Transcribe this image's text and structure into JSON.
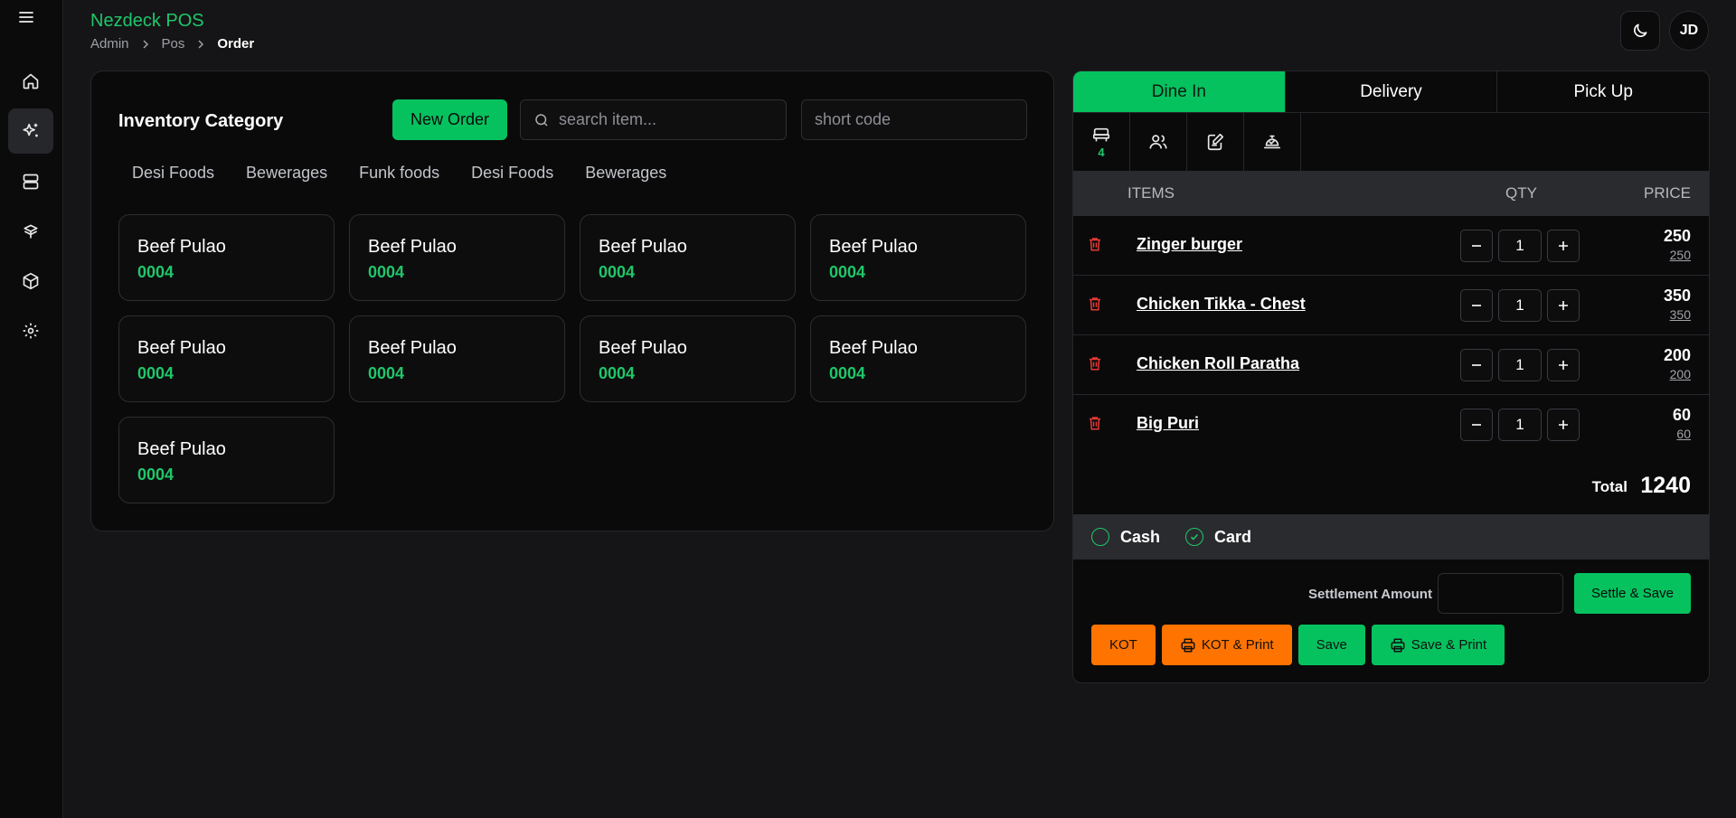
{
  "header": {
    "app_title": "Nezdeck POS",
    "breadcrumb": [
      "Admin",
      "Pos",
      "Order"
    ],
    "avatar_initials": "JD"
  },
  "sidebar": {
    "items": [
      {
        "icon": "home-icon"
      },
      {
        "icon": "sparkle-icon",
        "active": true
      },
      {
        "icon": "server-icon"
      },
      {
        "icon": "layers-icon"
      },
      {
        "icon": "box-icon"
      },
      {
        "icon": "gear-icon"
      }
    ]
  },
  "inventory": {
    "title": "Inventory Category",
    "new_order_label": "New Order",
    "search_placeholder": "search item...",
    "code_placeholder": "short code",
    "categories": [
      "Desi Foods",
      "Bewerages",
      "Funk foods",
      "Desi Foods",
      "Bewerages"
    ],
    "items": [
      {
        "name": "Beef Pulao",
        "code": "0004"
      },
      {
        "name": "Beef Pulao",
        "code": "0004"
      },
      {
        "name": "Beef Pulao",
        "code": "0004"
      },
      {
        "name": "Beef Pulao",
        "code": "0004"
      },
      {
        "name": "Beef Pulao",
        "code": "0004"
      },
      {
        "name": "Beef Pulao",
        "code": "0004"
      },
      {
        "name": "Beef Pulao",
        "code": "0004"
      },
      {
        "name": "Beef Pulao",
        "code": "0004"
      },
      {
        "name": "Beef Pulao",
        "code": "0004"
      }
    ]
  },
  "order": {
    "tabs": [
      "Dine In",
      "Delivery",
      "Pick Up"
    ],
    "active_tab": "Dine In",
    "table_badge": "4",
    "columns": {
      "items": "ITEMS",
      "qty": "QTY",
      "price": "PRICE"
    },
    "rows": [
      {
        "name": "Zinger burger",
        "qty": "1",
        "price": "250",
        "unit": "250"
      },
      {
        "name": "Chicken Tikka - Chest",
        "qty": "1",
        "price": "350",
        "unit": "350"
      },
      {
        "name": "Chicken Roll Paratha",
        "qty": "1",
        "price": "200",
        "unit": "200"
      },
      {
        "name": "Big Puri",
        "qty": "1",
        "price": "60",
        "unit": "60"
      }
    ],
    "total_label": "Total",
    "total_value": "1240",
    "payment": {
      "cash": "Cash",
      "card": "Card",
      "selected": "Card"
    },
    "settlement_label": "Settlement Amount",
    "settle_save_label": "Settle & Save",
    "actions": {
      "kot": "KOT",
      "kot_print": "KOT & Print",
      "save": "Save",
      "save_print": "Save & Print"
    }
  },
  "colors": {
    "accent_green": "#05c25f",
    "accent_orange": "#ff7300",
    "delete_red": "#e53935",
    "background": "#151517"
  }
}
